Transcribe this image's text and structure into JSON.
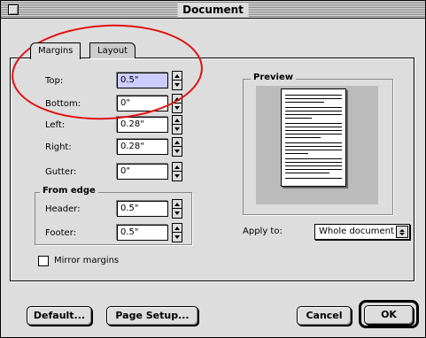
{
  "window": {
    "title": "Document"
  },
  "tabs": [
    {
      "label": "Margins",
      "active": true
    },
    {
      "label": "Layout",
      "active": false
    }
  ],
  "margins": {
    "top_label": "Top:",
    "top_value": "0.5\"",
    "bottom_label": "Bottom:",
    "bottom_value": "0\"",
    "left_label": "Left:",
    "left_value": "0.28\"",
    "right_label": "Right:",
    "right_value": "0.28\"",
    "gutter_label": "Gutter:",
    "gutter_value": "0\""
  },
  "from_edge": {
    "title": "From edge",
    "header_label": "Header:",
    "header_value": "0.5\"",
    "footer_label": "Footer:",
    "footer_value": "0.5\""
  },
  "preview": {
    "title": "Preview"
  },
  "apply_to": {
    "label": "Apply to:",
    "value": "Whole document"
  },
  "mirror_margins": {
    "label": "Mirror margins",
    "checked": false
  },
  "buttons": {
    "default": "Default...",
    "page_setup": "Page Setup...",
    "cancel": "Cancel",
    "ok": "OK"
  },
  "colors": {
    "selected_field": "#ccccff",
    "annotation": "#e01010",
    "dialog_bg": "#dddddd"
  }
}
